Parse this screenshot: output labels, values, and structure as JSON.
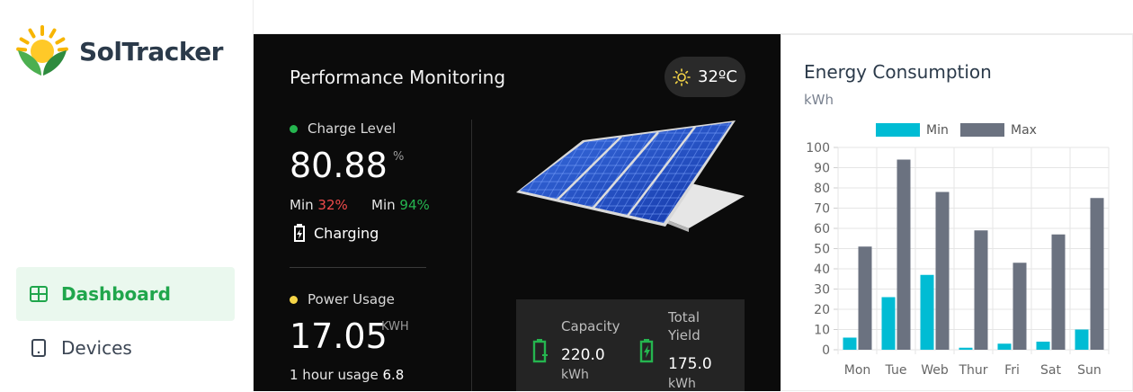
{
  "app": {
    "name": "SolTracker"
  },
  "nav": {
    "dashboard": "Dashboard",
    "devices": "Devices"
  },
  "performance": {
    "title": "Performance Monitoring",
    "temperature": "32ºC",
    "charge": {
      "label": "Charge Level",
      "value": "80.88",
      "unit": "%",
      "min_label": "Min",
      "min_value": "32%",
      "max_label": "Min",
      "max_value": "94%",
      "status": "Charging"
    },
    "power": {
      "label": "Power Usage",
      "value": "17.05",
      "unit": "KWH",
      "usage_text": "1 hour usage",
      "usage_value": "6.8"
    },
    "capacity": {
      "label": "Capacity",
      "value": "220.0",
      "unit": "kWh"
    },
    "total_yield": {
      "label_line1": "Total",
      "label_line2": "Yield",
      "value": "175.0",
      "unit": "kWh"
    }
  },
  "colors": {
    "accent_green": "#20a64c",
    "min_red": "#ef4b4b",
    "charge_dot": "#25b54f",
    "power_dot": "#f5d547",
    "series_min": "#00bcd4",
    "series_max": "#6b7280"
  },
  "icons": {
    "logo": "sun-leaf-logo",
    "dashboard": "grid-icon",
    "devices": "tablet-icon",
    "weather": "sun-icon",
    "charging": "battery-charging-icon",
    "capacity": "battery-plus-icon",
    "yield": "battery-bolt-icon"
  },
  "chart": {
    "title": "Energy Consumption",
    "subtitle": "kWh"
  },
  "chart_data": {
    "type": "bar",
    "title": "Energy Consumption",
    "ylabel": "kWh",
    "categories": [
      "Mon",
      "Tue",
      "Web",
      "Thur",
      "Fri",
      "Sat",
      "Sun"
    ],
    "series": [
      {
        "name": "Min",
        "values": [
          6,
          26,
          37,
          1,
          3,
          4,
          10
        ]
      },
      {
        "name": "Max",
        "values": [
          51,
          94,
          78,
          59,
          43,
          57,
          75
        ]
      }
    ],
    "ylim": [
      0,
      100
    ],
    "yticks": [
      0,
      10,
      20,
      30,
      40,
      50,
      60,
      70,
      80,
      90,
      100
    ],
    "grid": true,
    "legend": "top"
  }
}
